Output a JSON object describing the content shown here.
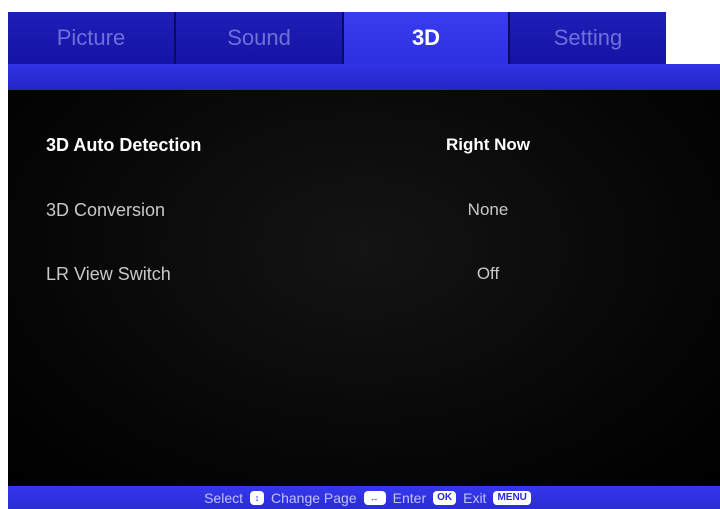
{
  "tabs": [
    {
      "label": "Picture",
      "active": false
    },
    {
      "label": "Sound",
      "active": false
    },
    {
      "label": "3D",
      "active": true
    },
    {
      "label": "Setting",
      "active": false
    }
  ],
  "settings": [
    {
      "label": "3D Auto Detection",
      "value": "Right Now",
      "selected": true
    },
    {
      "label": "3D Conversion",
      "value": "None",
      "selected": false
    },
    {
      "label": "LR View Switch",
      "value": "Off",
      "selected": false
    }
  ],
  "footer": {
    "select_label": "Select",
    "change_page_label": "Change Page",
    "enter_label": "Enter",
    "enter_key": "OK",
    "exit_label": "Exit",
    "exit_key": "MENU"
  },
  "colors": {
    "tab_bar": "#1d1fb8",
    "active_tab": "#3a3cf0",
    "inactive_tab_text": "#6e70d8",
    "content_bg": "#000000",
    "footer_bg": "#3537ee"
  }
}
